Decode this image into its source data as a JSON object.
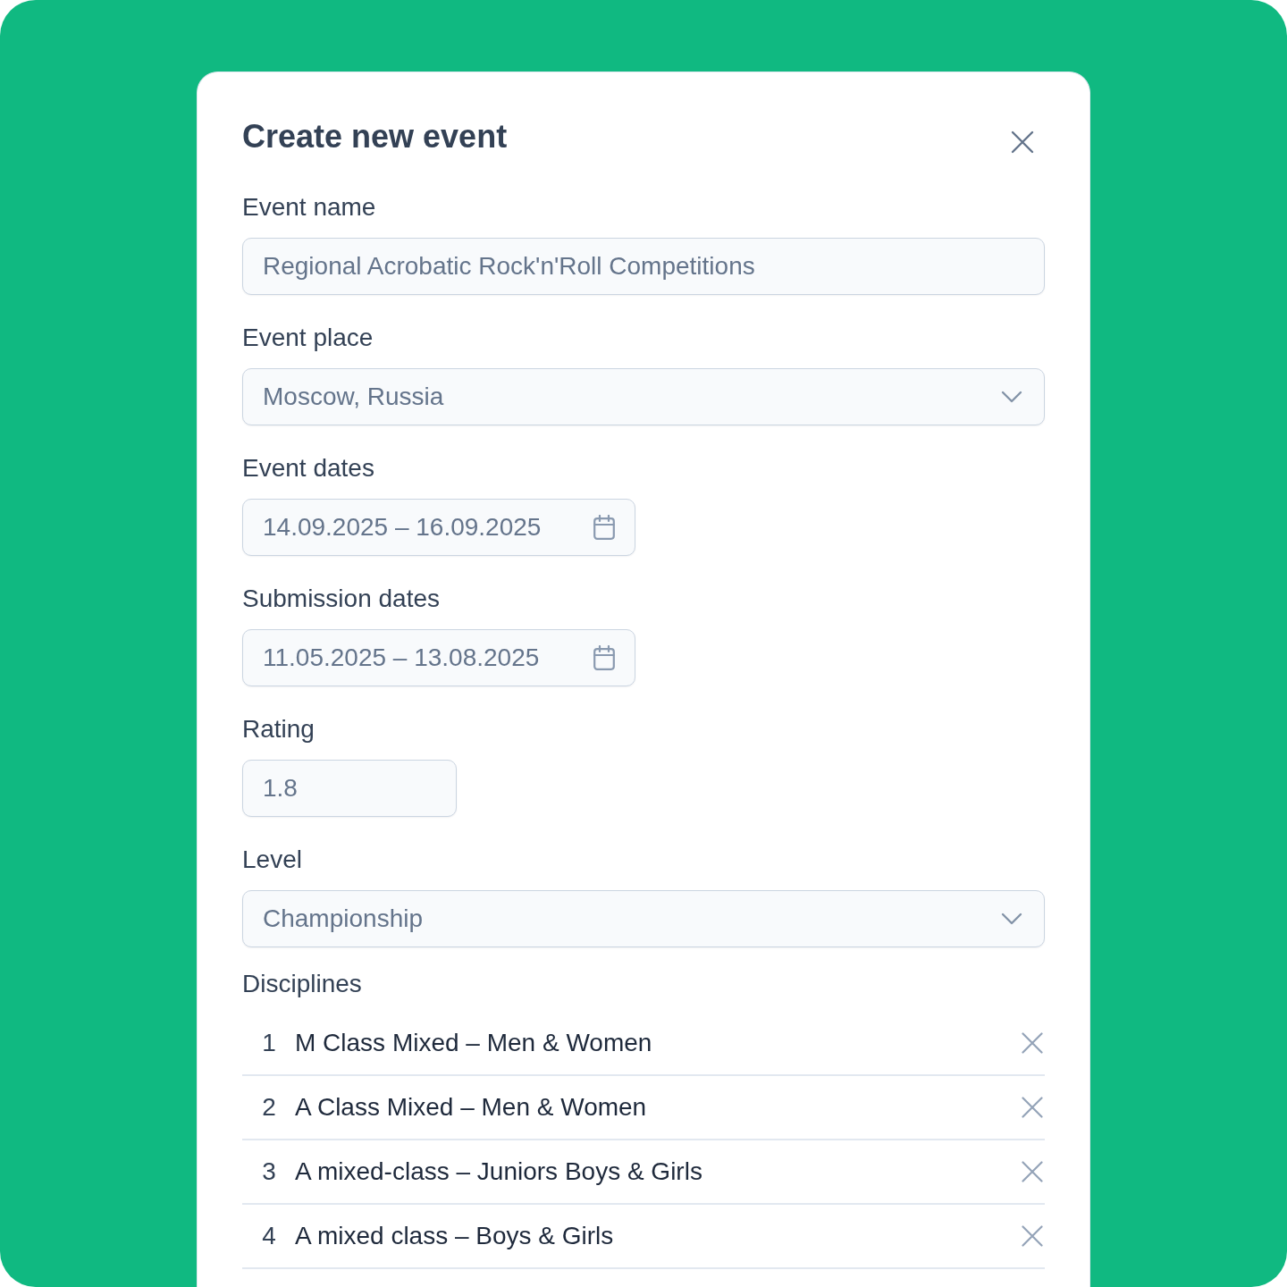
{
  "dialog": {
    "title": "Create new event"
  },
  "fields": [
    {
      "kind": "text",
      "label": "Event name",
      "value": "Regional Acrobatic Rock'n'Roll Competitions"
    },
    {
      "kind": "select",
      "label": "Event place",
      "value": "Moscow, Russia"
    },
    {
      "kind": "date_range",
      "label": "Event dates",
      "value": "14.09.2025 – 16.09.2025"
    },
    {
      "kind": "date_range",
      "label": "Submission dates",
      "value": "11.05.2025 – 13.08.2025"
    },
    {
      "kind": "number",
      "label": "Rating",
      "value": "1.8"
    },
    {
      "kind": "select",
      "label": "Level",
      "value": "Championship"
    }
  ],
  "disciplines": {
    "label": "Disciplines",
    "items": [
      {
        "number": "1",
        "name": "M Class Mixed – Men & Women"
      },
      {
        "number": "2",
        "name": "A Class Mixed – Men & Women"
      },
      {
        "number": "3",
        "name": "A mixed-class – Juniors Boys & Girls"
      },
      {
        "number": "4",
        "name": "A mixed class – Boys & Girls"
      }
    ]
  }
}
